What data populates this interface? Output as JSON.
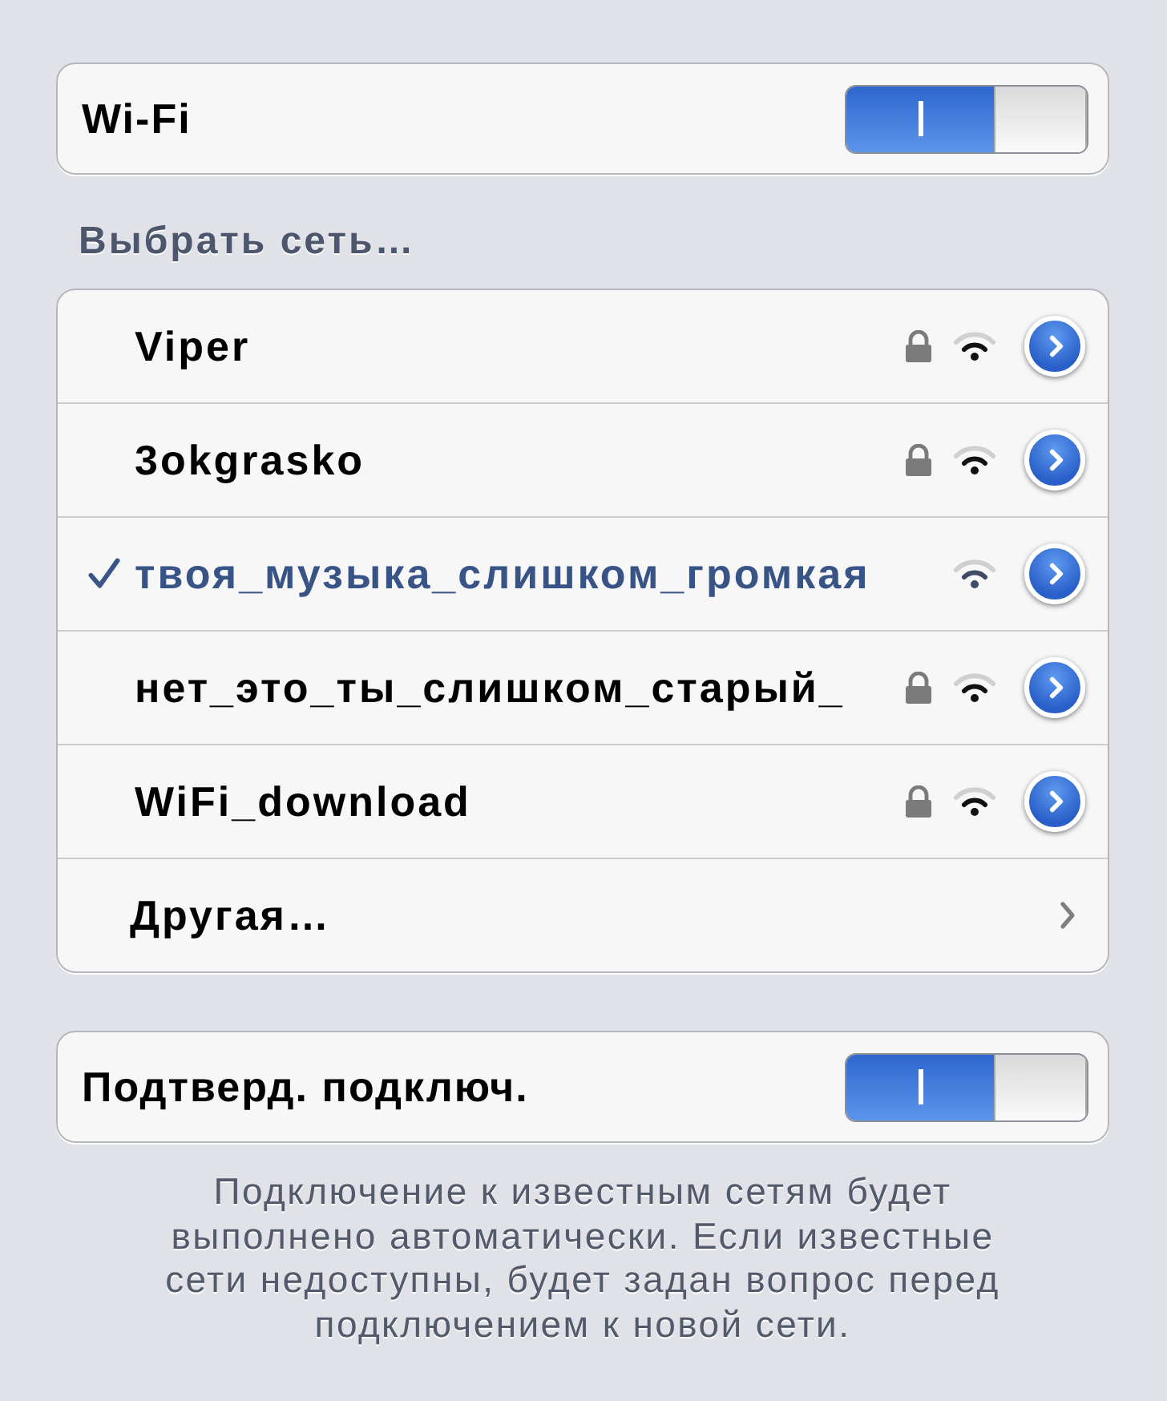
{
  "wifi": {
    "label": "Wi-Fi",
    "on": true
  },
  "networks_heading": "Выбрать сеть…",
  "networks": [
    {
      "name": "Viper",
      "selected": false,
      "locked": true
    },
    {
      "name": "3okgrasko",
      "selected": false,
      "locked": true
    },
    {
      "name": "твоя_музыка_слишком_громкая",
      "selected": true,
      "locked": false
    },
    {
      "name": "нет_это_ты_слишком_старый_",
      "selected": false,
      "locked": true
    },
    {
      "name": "WiFi_download",
      "selected": false,
      "locked": true
    }
  ],
  "other_network": {
    "label": "Другая…"
  },
  "ask_to_join": {
    "label": "Подтверд. подключ.",
    "on": true
  },
  "footer_note": "Подключение к известным сетям будет выполнено автоматически. Если известные сети недоступны, будет задан вопрос перед подключением к новой сети."
}
